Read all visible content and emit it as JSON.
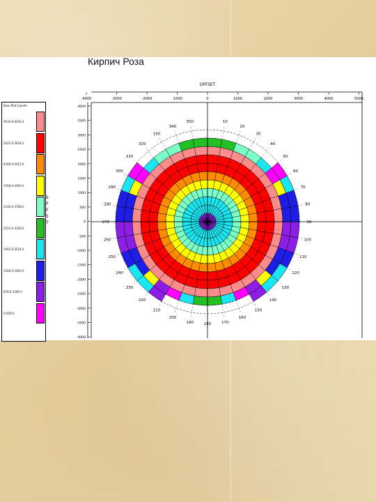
{
  "slide": {
    "title": "Кирпич Роза"
  },
  "legend": {
    "title": "Rose Plot Counts",
    "side_text": [
      "O",
      "F",
      "F",
      "S",
      "T"
    ],
    "items": [
      {
        "label": "5634.0-6256.4",
        "color": "#fa8c8c"
      },
      {
        "label": "5012.0-5634.0",
        "color": "#ff0000"
      },
      {
        "label": "4390.0-5012.0",
        "color": "#ff8c00"
      },
      {
        "label": "3768.0-4390.0",
        "color": "#ffff00"
      },
      {
        "label": "3146.0-3768.0",
        "color": "#7dffc8"
      },
      {
        "label": "2524.0-3146.0",
        "color": "#22c022"
      },
      {
        "label": "1902.0-2524.0",
        "color": "#19e6f0"
      },
      {
        "label": "1280.0-1902.0",
        "color": "#1e1ee6"
      },
      {
        "label": "658.0-1280.0",
        "color": "#8c1ee6"
      },
      {
        "label": "0-658.0",
        "color": "#ff00ff"
      }
    ]
  },
  "chart_data": {
    "type": "heatmap",
    "subtype": "polar rose plot (offset × azimuth)",
    "title": "",
    "xlabel": "OFFSET",
    "ylabel": "OFFSET",
    "xlim": [
      -4000,
      5000
    ],
    "ylim": [
      -4000,
      4000
    ],
    "x_ticks": [
      "-4000",
      "-3000",
      "-2000",
      "-1000",
      "0",
      "1000",
      "2000",
      "3000",
      "4000",
      "5000"
    ],
    "y_ticks": [
      "4000",
      "3500",
      "3000",
      "2500",
      "2000",
      "1500",
      "1000",
      "500",
      "0",
      "-500",
      "-1000",
      "-1500",
      "-2000",
      "-2500",
      "-3000",
      "-3500",
      "-4000"
    ],
    "azimuth_labels": [
      "350",
      "10",
      "20",
      "30",
      "40",
      "50",
      "60",
      "70",
      "80",
      "90",
      "100",
      "110",
      "120",
      "130",
      "140",
      "150",
      "160",
      "170",
      "180",
      "190",
      "200",
      "210",
      "220",
      "230",
      "240",
      "250",
      "260",
      "270",
      "280",
      "290",
      "300",
      "310",
      "320",
      "330",
      "340"
    ],
    "azimuth_bins_deg": 10,
    "offset_ring_edges": [
      0,
      300,
      600,
      900,
      1200,
      1500,
      1800,
      2100,
      2400,
      2700,
      3000,
      3300
    ],
    "legend_position": "left",
    "grid": true,
    "ring_colors": [
      "#8c1ee6",
      "#19e6f0",
      "#19e6f0",
      "#7dffc8",
      "#ffff00",
      "#ff8c00",
      "#ff0000",
      "#ff0000",
      "#fa8c8c",
      "#19e6f0",
      "",
      ""
    ],
    "outer_sector_colors": {
      "ring_9": [
        "#22c022",
        "#22c022",
        "#7dffc8",
        "#7dffc8",
        "#19e6f0",
        "#ff00ff",
        "#ffff00",
        "#1e1ee6",
        "#1e1ee6",
        "#8c1ee6",
        "#8c1ee6",
        "#1e1ee6",
        "#1e1ee6",
        "#ffff00",
        "#8c1ee6",
        "#ff00ff",
        "#19e6f0",
        "#22c022",
        "#22c022",
        "#19e6f0",
        "#ff00ff",
        "#8c1ee6",
        "#ffff00",
        "#1e1ee6",
        "#1e1ee6",
        "#8c1ee6",
        "#8c1ee6",
        "#1e1ee6",
        "#1e1ee6",
        "#ffff00",
        "#ff00ff",
        "#19e6f0",
        "#7dffc8",
        "#7dffc8",
        "#22c022",
        "#22c022"
      ],
      "ring_10": [
        "",
        "",
        "",
        "",
        "",
        "#ff00ff",
        "#19e6f0",
        "#1e1ee6",
        "#1e1ee6",
        "#8c1ee6",
        "#8c1ee6",
        "#1e1ee6",
        "#19e6f0",
        "#19e6f0",
        "#8c1ee6",
        "",
        "",
        "",
        "",
        "",
        "",
        "#8c1ee6",
        "#19e6f0",
        "#19e6f0",
        "#1e1ee6",
        "#8c1ee6",
        "#8c1ee6",
        "#1e1ee6",
        "#1e1ee6",
        "#19e6f0",
        "#ff00ff",
        "",
        "",
        "",
        "",
        ""
      ]
    }
  }
}
